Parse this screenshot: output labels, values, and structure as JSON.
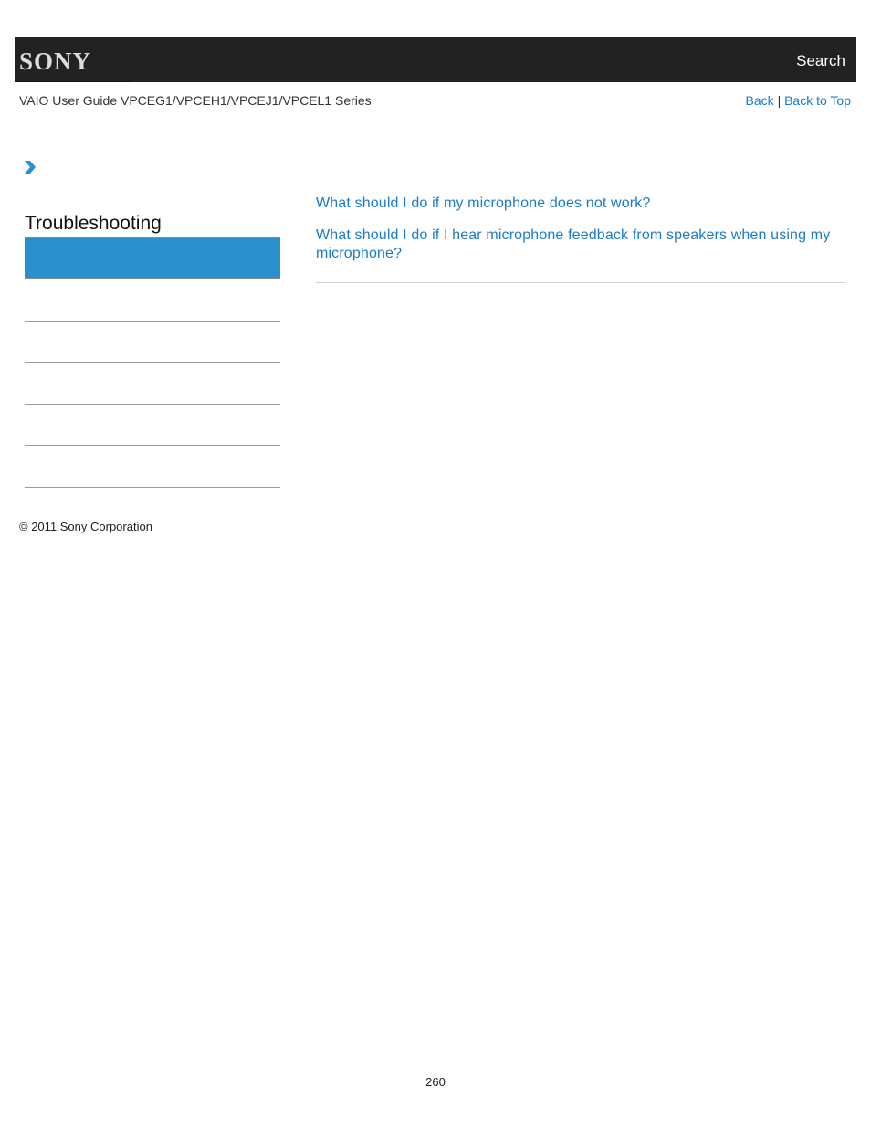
{
  "header": {
    "logo": "SONY",
    "search_label": "Search"
  },
  "subheader": {
    "title": "VAIO User Guide VPCEG1/VPCEH1/VPCEJ1/VPCEL1 Series",
    "back_label": "Back",
    "separator": "|",
    "back_to_top_label": "Back to Top"
  },
  "sidebar": {
    "breadcrumb_icon": "chevron-right-icon",
    "section_title": "Troubleshooting",
    "accent_color": "#2a8fcd"
  },
  "main": {
    "links": [
      "What should I do if my microphone does not work?",
      "What should I do if I hear microphone feedback from speakers when using my microphone?"
    ],
    "link_color": "#1a7bc9"
  },
  "footer": {
    "copyright": "© 2011 Sony Corporation",
    "page_number": "260"
  }
}
